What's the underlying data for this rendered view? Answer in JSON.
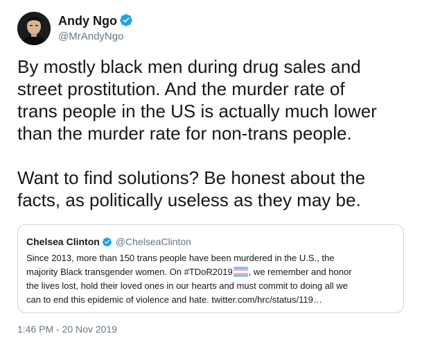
{
  "author": {
    "name": "Andy Ngo",
    "handle": "@MrAndyNgo"
  },
  "tweet": {
    "lines": [
      "By mostly black men during drug sales and",
      "street prostitution. And the murder rate of",
      "trans people in the US is actually much lower",
      "than the murder rate for non-trans people."
    ],
    "lines2": [
      "Want to find solutions? Be honest about the",
      "facts, as politically useless as they may be."
    ]
  },
  "quote": {
    "name": "Chelsea Clinton",
    "handle": "@ChelseaClinton",
    "line1": "Since 2013, more than 150 trans people have been murdered in the U.S., the",
    "line2_before": "majority Black transgender women. On #TDoR2019",
    "line2_after": ", we remember and honor",
    "line3": "the lives lost, hold their loved ones in our hearts and must commit to doing all we",
    "line4": "can to end this epidemic of violence and hate. twitter.com/hrc/status/119…"
  },
  "timestamp": "1:46 PM - 20 Nov 2019",
  "icons": {
    "verified": "verified-badge-icon",
    "flag": "transgender-flag-icon"
  },
  "colors": {
    "verified_blue": "#1da1f2",
    "secondary_text": "#657786",
    "card_border": "#ccd6dd",
    "flag_blue": "#5bcefa",
    "flag_pink": "#f5a9b8"
  }
}
